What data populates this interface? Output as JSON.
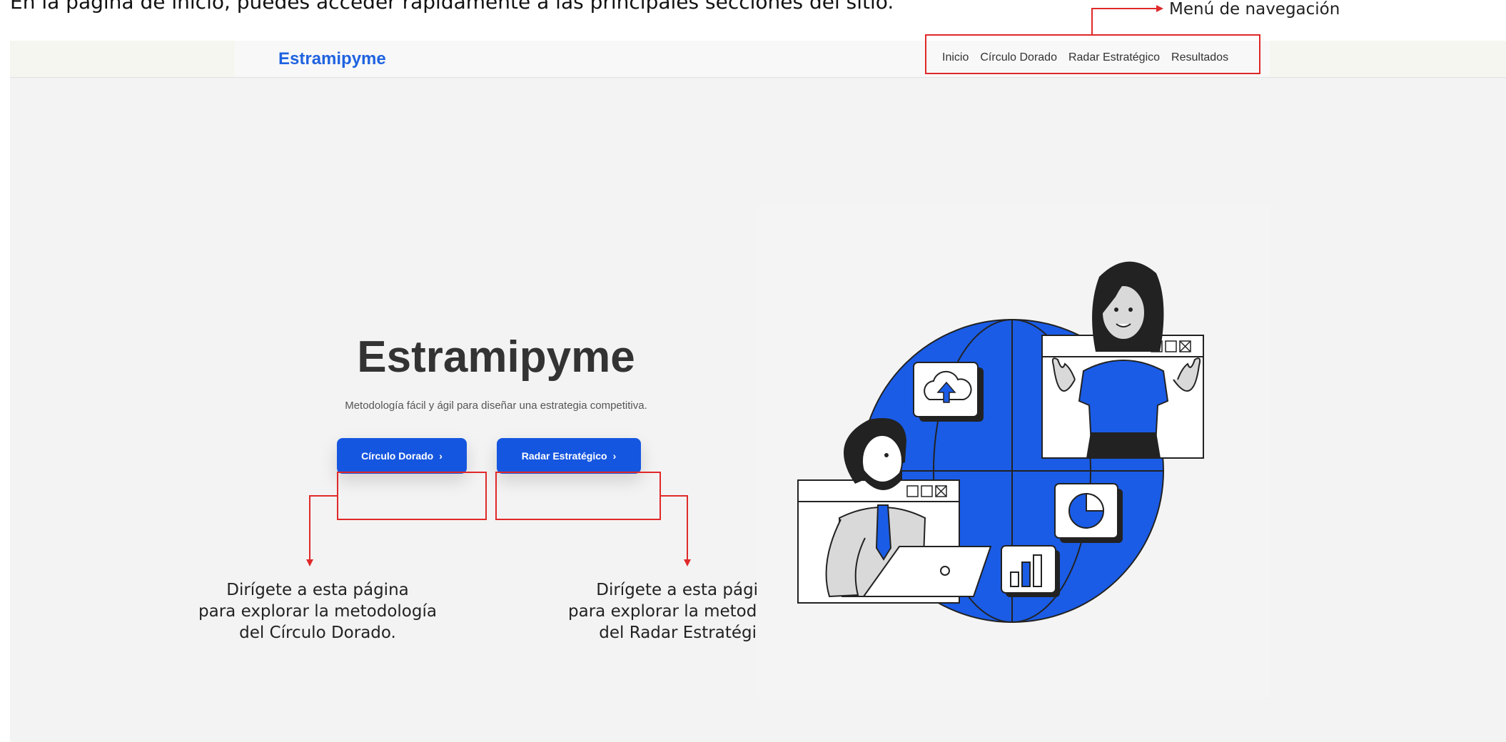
{
  "caption": "En la página de inicio, puedes acceder rápidamente a las principales secciones del sitio.",
  "navbar": {
    "brand": "Estramipyme",
    "links": [
      "Inicio",
      "Círculo Dorado",
      "Radar Estratégico",
      "Resultados"
    ]
  },
  "hero": {
    "title": "Estramipyme",
    "subtitle": "Metodología fácil y ágil para diseñar una estrategia competitiva.",
    "btn1_label": "Círculo Dorado",
    "btn2_label": "Radar Estratégico"
  },
  "annotations": {
    "menu": "Menú de navegación",
    "circulo_lines": [
      "Dirígete a esta página",
      "para explorar la metodología",
      "del Círculo Dorado."
    ],
    "radar_lines": [
      "Dirígete a esta página",
      "para explorar la metodología",
      "del Radar Estratégico"
    ]
  },
  "colors": {
    "brand": "#1f63e0",
    "button": "#1556e0",
    "annotation": "#e0292a",
    "illustration": "#1a5ce6"
  },
  "icons": [
    "chevron-right-icon",
    "cloud-upload-icon",
    "pie-chart-icon",
    "bar-chart-icon",
    "window-controls-icon"
  ]
}
